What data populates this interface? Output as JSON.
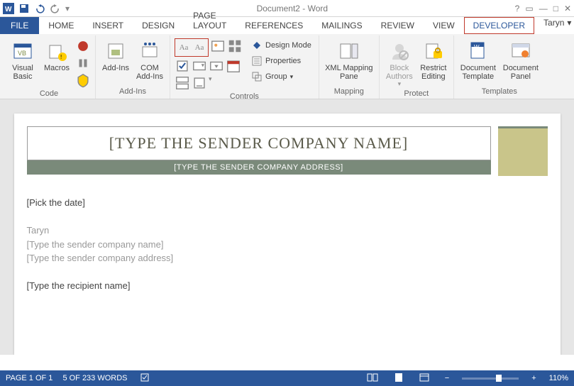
{
  "titlebar": {
    "title": "Document2 - Word"
  },
  "tabs": {
    "file": "FILE",
    "home": "HOME",
    "insert": "INSERT",
    "design": "DESIGN",
    "pagelayout": "PAGE LAYOUT",
    "references": "REFERENCES",
    "mailings": "MAILINGS",
    "review": "REVIEW",
    "view": "VIEW",
    "developer": "DEVELOPER",
    "user": "Taryn"
  },
  "ribbon": {
    "code": {
      "visualbasic": "Visual Basic",
      "macros": "Macros",
      "label": "Code"
    },
    "addins": {
      "addins": "Add-Ins",
      "com": "COM Add-Ins",
      "label": "Add-Ins"
    },
    "controls": {
      "designmode": "Design Mode",
      "properties": "Properties",
      "group": "Group",
      "label": "Controls"
    },
    "mapping": {
      "xmlpane": "XML Mapping Pane",
      "label": "Mapping"
    },
    "protect": {
      "block": "Block Authors",
      "restrict": "Restrict Editing",
      "label": "Protect"
    },
    "templates": {
      "doctpl": "Document Template",
      "docpanel": "Document Panel",
      "label": "Templates"
    }
  },
  "doc": {
    "company_name": "[TYPE THE SENDER COMPANY NAME]",
    "company_addr": "[TYPE THE SENDER COMPANY ADDRESS]",
    "pick_date": "[Pick the date]",
    "author": "Taryn",
    "sender_company": "[Type the sender company name]",
    "sender_address": "[Type the sender company address]",
    "recipient": "[Type the recipient name]"
  },
  "status": {
    "page": "PAGE 1 OF 1",
    "words": "5 OF 233 WORDS",
    "zoom": "110%"
  }
}
